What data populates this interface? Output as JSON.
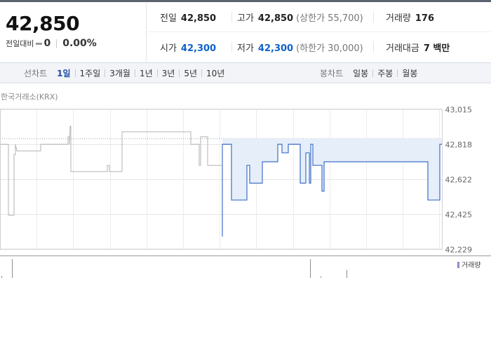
{
  "quote": {
    "price": "42,850",
    "change_label": "전일대비",
    "change_value": "0",
    "change_rate": "0.00%",
    "stats": [
      {
        "label": "전일",
        "value": "42,850",
        "note": "",
        "color": "#222222"
      },
      {
        "label": "고가",
        "value": "42,850",
        "note": "(상한가 55,700)",
        "color": "#222222"
      },
      {
        "label": "거래량",
        "value": "176",
        "note": "",
        "color": "#222222"
      },
      {
        "label": "시가",
        "value": "42,300",
        "note": "",
        "color": "#1061c8"
      },
      {
        "label": "저가",
        "value": "42,300",
        "note": "(하한가 30,000)",
        "color": "#1061c8"
      },
      {
        "label": "거래대금",
        "value": "7 백만",
        "note": "",
        "color": "#222222"
      }
    ]
  },
  "tabs": {
    "line_title": "선차트",
    "line_items": [
      "1일",
      "1주일",
      "3개월",
      "1년",
      "3년",
      "5년",
      "10년"
    ],
    "line_active": 0,
    "candle_title": "봉차트",
    "candle_items": [
      "일봉",
      "주봉",
      "월봉"
    ]
  },
  "source": "한국거래소(KRX)",
  "chart_data": {
    "type": "line",
    "y_ticks": [
      "43,015",
      "42,818",
      "42,622",
      "42,425",
      "42,229"
    ],
    "ylim": [
      42229,
      43015
    ],
    "xlim": [
      0,
      630
    ],
    "grid": true,
    "legend": "거래량",
    "colors": {
      "today": "#3d6fc9",
      "today_fill": "#e6eef9",
      "previous": "#b3b3b3",
      "volume_bar": "#9b87c8"
    },
    "previous_day": [
      [
        0,
        42818
      ],
      [
        12,
        42818
      ],
      [
        12,
        42420
      ],
      [
        20,
        42420
      ],
      [
        20,
        42760
      ],
      [
        22,
        42760
      ],
      [
        22,
        42818
      ],
      [
        24,
        42780
      ],
      [
        58,
        42780
      ],
      [
        58,
        42818
      ],
      [
        97,
        42818
      ],
      [
        97,
        42860
      ],
      [
        99,
        42860
      ],
      [
        99,
        42818
      ],
      [
        100,
        42920
      ],
      [
        101,
        42920
      ],
      [
        101,
        42665
      ],
      [
        153,
        42665
      ],
      [
        153,
        42700
      ],
      [
        156,
        42700
      ],
      [
        156,
        42665
      ],
      [
        174,
        42665
      ],
      [
        174,
        42888
      ],
      [
        272,
        42888
      ],
      [
        272,
        42818
      ],
      [
        284,
        42818
      ],
      [
        284,
        42700
      ],
      [
        286,
        42700
      ],
      [
        286,
        42860
      ],
      [
        296,
        42860
      ],
      [
        296,
        42700
      ],
      [
        316,
        42700
      ]
    ],
    "today": [
      [
        317,
        42300
      ],
      [
        317,
        42818
      ],
      [
        330,
        42818
      ],
      [
        330,
        42505
      ],
      [
        352,
        42505
      ],
      [
        352,
        42700
      ],
      [
        356,
        42700
      ],
      [
        356,
        42600
      ],
      [
        374,
        42600
      ],
      [
        374,
        42720
      ],
      [
        396,
        42720
      ],
      [
        396,
        42818
      ],
      [
        402,
        42818
      ],
      [
        402,
        42770
      ],
      [
        411,
        42770
      ],
      [
        411,
        42818
      ],
      [
        428,
        42818
      ],
      [
        428,
        42600
      ],
      [
        436,
        42600
      ],
      [
        436,
        42770
      ],
      [
        441,
        42770
      ],
      [
        441,
        42600
      ],
      [
        443,
        42600
      ],
      [
        443,
        42818
      ],
      [
        446,
        42818
      ],
      [
        446,
        42700
      ],
      [
        459,
        42700
      ],
      [
        459,
        42555
      ],
      [
        462,
        42555
      ],
      [
        462,
        42720
      ],
      [
        610,
        42720
      ],
      [
        610,
        42505
      ],
      [
        627,
        42505
      ],
      [
        627,
        42818
      ],
      [
        630,
        42818
      ]
    ],
    "volume": [
      [
        17,
        0.95
      ],
      [
        442,
        0.95
      ],
      [
        494,
        0.4
      ],
      [
        2,
        0.1
      ],
      [
        457,
        0.08
      ]
    ]
  }
}
